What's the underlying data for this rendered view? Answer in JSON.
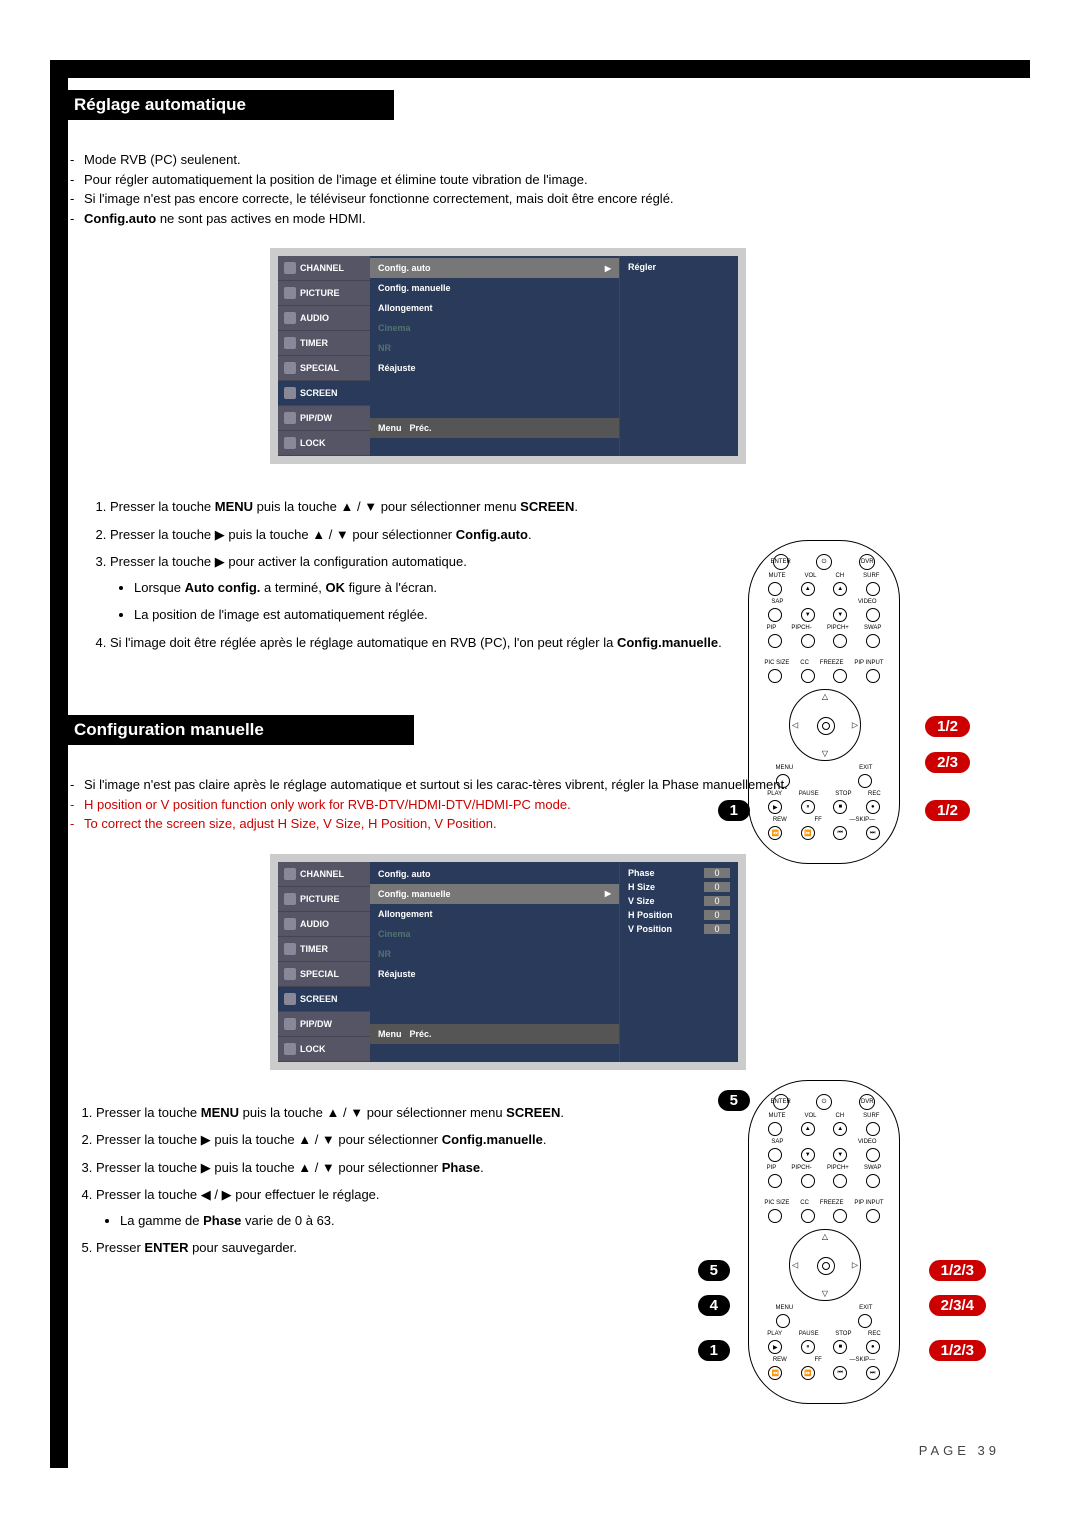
{
  "section1": {
    "title": "Réglage automatique",
    "note1": "Mode RVB (PC) seulenent.",
    "note2": "Pour régler automatiquement la position de l'image et élimine toute vibration de l'image.",
    "note3": "Si l'image n'est pas encore correcte, le téléviseur fonctionne correctement, mais doit être encore réglé.",
    "note4a": "Config.auto",
    "note4b": " ne sont pas actives en mode HDMI.",
    "osd": {
      "side": [
        "CHANNEL",
        "PICTURE",
        "AUDIO",
        "TIMER",
        "SPECIAL",
        "SCREEN",
        "PIP/DW",
        "LOCK"
      ],
      "rows": {
        "r1": "Config. auto",
        "r2": "Config. manuelle",
        "r3": "Allongement",
        "r4": "Cinema",
        "r5": "NR",
        "r6": "Réajuste"
      },
      "right": "Régler",
      "footer1": "Menu",
      "footer2": "Préc."
    },
    "steps": {
      "s1a": "Presser la touche ",
      "s1b": "MENU",
      "s1c": " puis la touche ▲ / ▼ pour sélectionner menu ",
      "s1d": "SCREEN",
      "s1e": ".",
      "s2a": "Presser la touche ▶ puis la touche ▲ / ▼ pour sélectionner ",
      "s2b": "Config.auto",
      "s2c": ".",
      "s3": "Presser la touche ▶ pour activer la configuration automatique.",
      "s3b1a": "Lorsque ",
      "s3b1b": "Auto config.",
      "s3b1c": " a terminé, ",
      "s3b1d": "OK",
      "s3b1e": " figure à l'écran.",
      "s3b2": "La position de l'image est automatiquement réglée.",
      "s4a": "Si l'image doit être réglée après le réglage automatique en RVB (PC), l'on peut régler la ",
      "s4b": "Config.manuelle",
      "s4c": "."
    },
    "callouts": {
      "c1": "1",
      "c2": "1/2",
      "c3": "2/3",
      "c4": "1/2"
    }
  },
  "section2": {
    "title": "Configuration manuelle",
    "note1": "Si l'image n'est pas claire après le réglage automatique et surtout si les carac-tères vibrent, régler la Phase manuellement.",
    "note2": "H position or V position function only work for RVB-DTV/HDMI-DTV/HDMI-PC mode.",
    "note3": "To correct the screen size, adjust H Size, V Size, H Position, V Position.",
    "osd": {
      "right": {
        "phase": "Phase",
        "hsize": "H Size",
        "vsize": "V Size",
        "hpos": "H Position",
        "vpos": "V Position",
        "val": "0"
      }
    },
    "steps": {
      "s1a": "Presser la touche ",
      "s1b": "MENU",
      "s1c": " puis la touche ▲ / ▼ pour sélectionner menu ",
      "s1d": "SCREEN",
      "s1e": ".",
      "s2a": "Presser la touche ▶ puis la touche ▲ / ▼ pour sélectionner ",
      "s2b": "Config.manuelle",
      "s2c": ".",
      "s3a": "Presser la touche ▶ puis la touche ▲ / ▼ pour sélectionner ",
      "s3b": "Phase",
      "s3c": ".",
      "s4": "Presser la touche ◀ / ▶ pour effectuer le réglage.",
      "s4b1a": "La gamme de ",
      "s4b1b": "Phase",
      "s4b1c": " varie de 0 à 63.",
      "s5a": "Presser ",
      "s5b": "ENTER",
      "s5c": " pour sauvegarder."
    },
    "callouts": {
      "c5a": "5",
      "c5b": "5",
      "c4": "4",
      "c1": "1",
      "r1": "1/2/3",
      "r2": "2/3/4",
      "r3": "1/2/3"
    }
  },
  "remote": {
    "enter": "ENTER",
    "dvr": "DVR",
    "mute": "MUTE",
    "vol": "VOL",
    "ch": "CH",
    "surf": "SURF",
    "sap": "SAP",
    "video": "VIDEO",
    "pip": "PIP",
    "pipch1": "PIPCH-",
    "pipch2": "PIPCH+",
    "swap": "SWAP",
    "picsize": "PIC SIZE",
    "cc": "CC",
    "freeze": "FREEZE",
    "pipinput": "PIP INPUT",
    "menu": "MENU",
    "exit": "EXIT",
    "play": "PLAY",
    "pause": "PAUSE",
    "stop": "STOP",
    "rec": "REC",
    "rew": "REW",
    "ff": "FF",
    "skip": "SKIP"
  },
  "pagenum": "PAGE 39"
}
